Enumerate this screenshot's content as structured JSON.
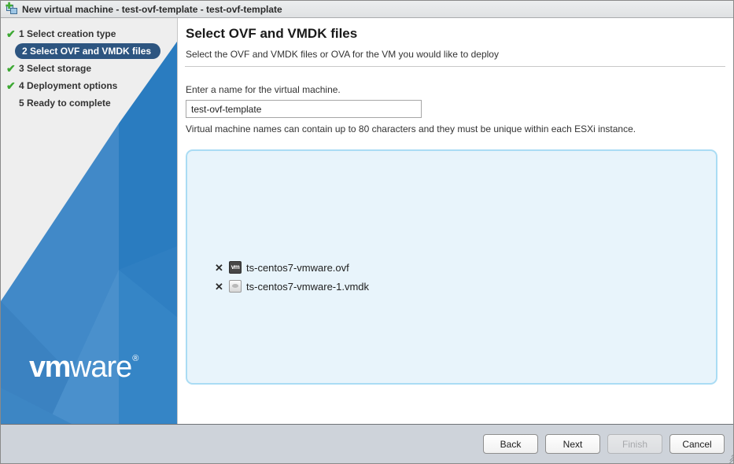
{
  "window": {
    "title": "New virtual machine - test-ovf-template - test-ovf-template",
    "icon": "new-vm-icon"
  },
  "sidebar": {
    "steps": [
      {
        "number": "1",
        "label": "1 Select creation type",
        "completed": true,
        "active": false,
        "check": "✔"
      },
      {
        "number": "2",
        "label": "2 Select OVF and VMDK files",
        "completed": false,
        "active": true,
        "check": ""
      },
      {
        "number": "3",
        "label": "3 Select storage",
        "completed": true,
        "active": false,
        "check": "✔"
      },
      {
        "number": "4",
        "label": "4 Deployment options",
        "completed": true,
        "active": false,
        "check": "✔"
      },
      {
        "number": "5",
        "label": "5 Ready to complete",
        "completed": false,
        "active": false,
        "check": ""
      }
    ],
    "logo": {
      "bold": "vm",
      "light": "ware",
      "registered": "®"
    },
    "accent_color": "#2d5580",
    "check_color": "#3ca832"
  },
  "main": {
    "title": "Select OVF and VMDK files",
    "subtitle": "Select the OVF and VMDK files or OVA for the VM you would like to deploy",
    "name_label": "Enter a name for the virtual machine.",
    "name_value": "test-ovf-template",
    "name_placeholder": "Enter a name for the virtual machine",
    "name_hint": "Virtual machine names can contain up to 80 characters and they must be unique within each ESXi instance.",
    "dropzone": {
      "background_color": "#e8f4fb",
      "border_color": "#aadcf4",
      "files": [
        {
          "name": "ts-centos7-vmware.ovf",
          "icon": "ovf-file-icon",
          "icon_text": "vm",
          "remove": "✕"
        },
        {
          "name": "ts-centos7-vmware-1.vmdk",
          "icon": "vmdk-disk-icon",
          "icon_text": "",
          "remove": "✕"
        }
      ]
    }
  },
  "footer": {
    "buttons": [
      {
        "label": "Back",
        "disabled": false,
        "name": "back-button"
      },
      {
        "label": "Next",
        "disabled": false,
        "name": "next-button"
      },
      {
        "label": "Finish",
        "disabled": true,
        "name": "finish-button"
      },
      {
        "label": "Cancel",
        "disabled": false,
        "name": "cancel-button"
      }
    ]
  }
}
